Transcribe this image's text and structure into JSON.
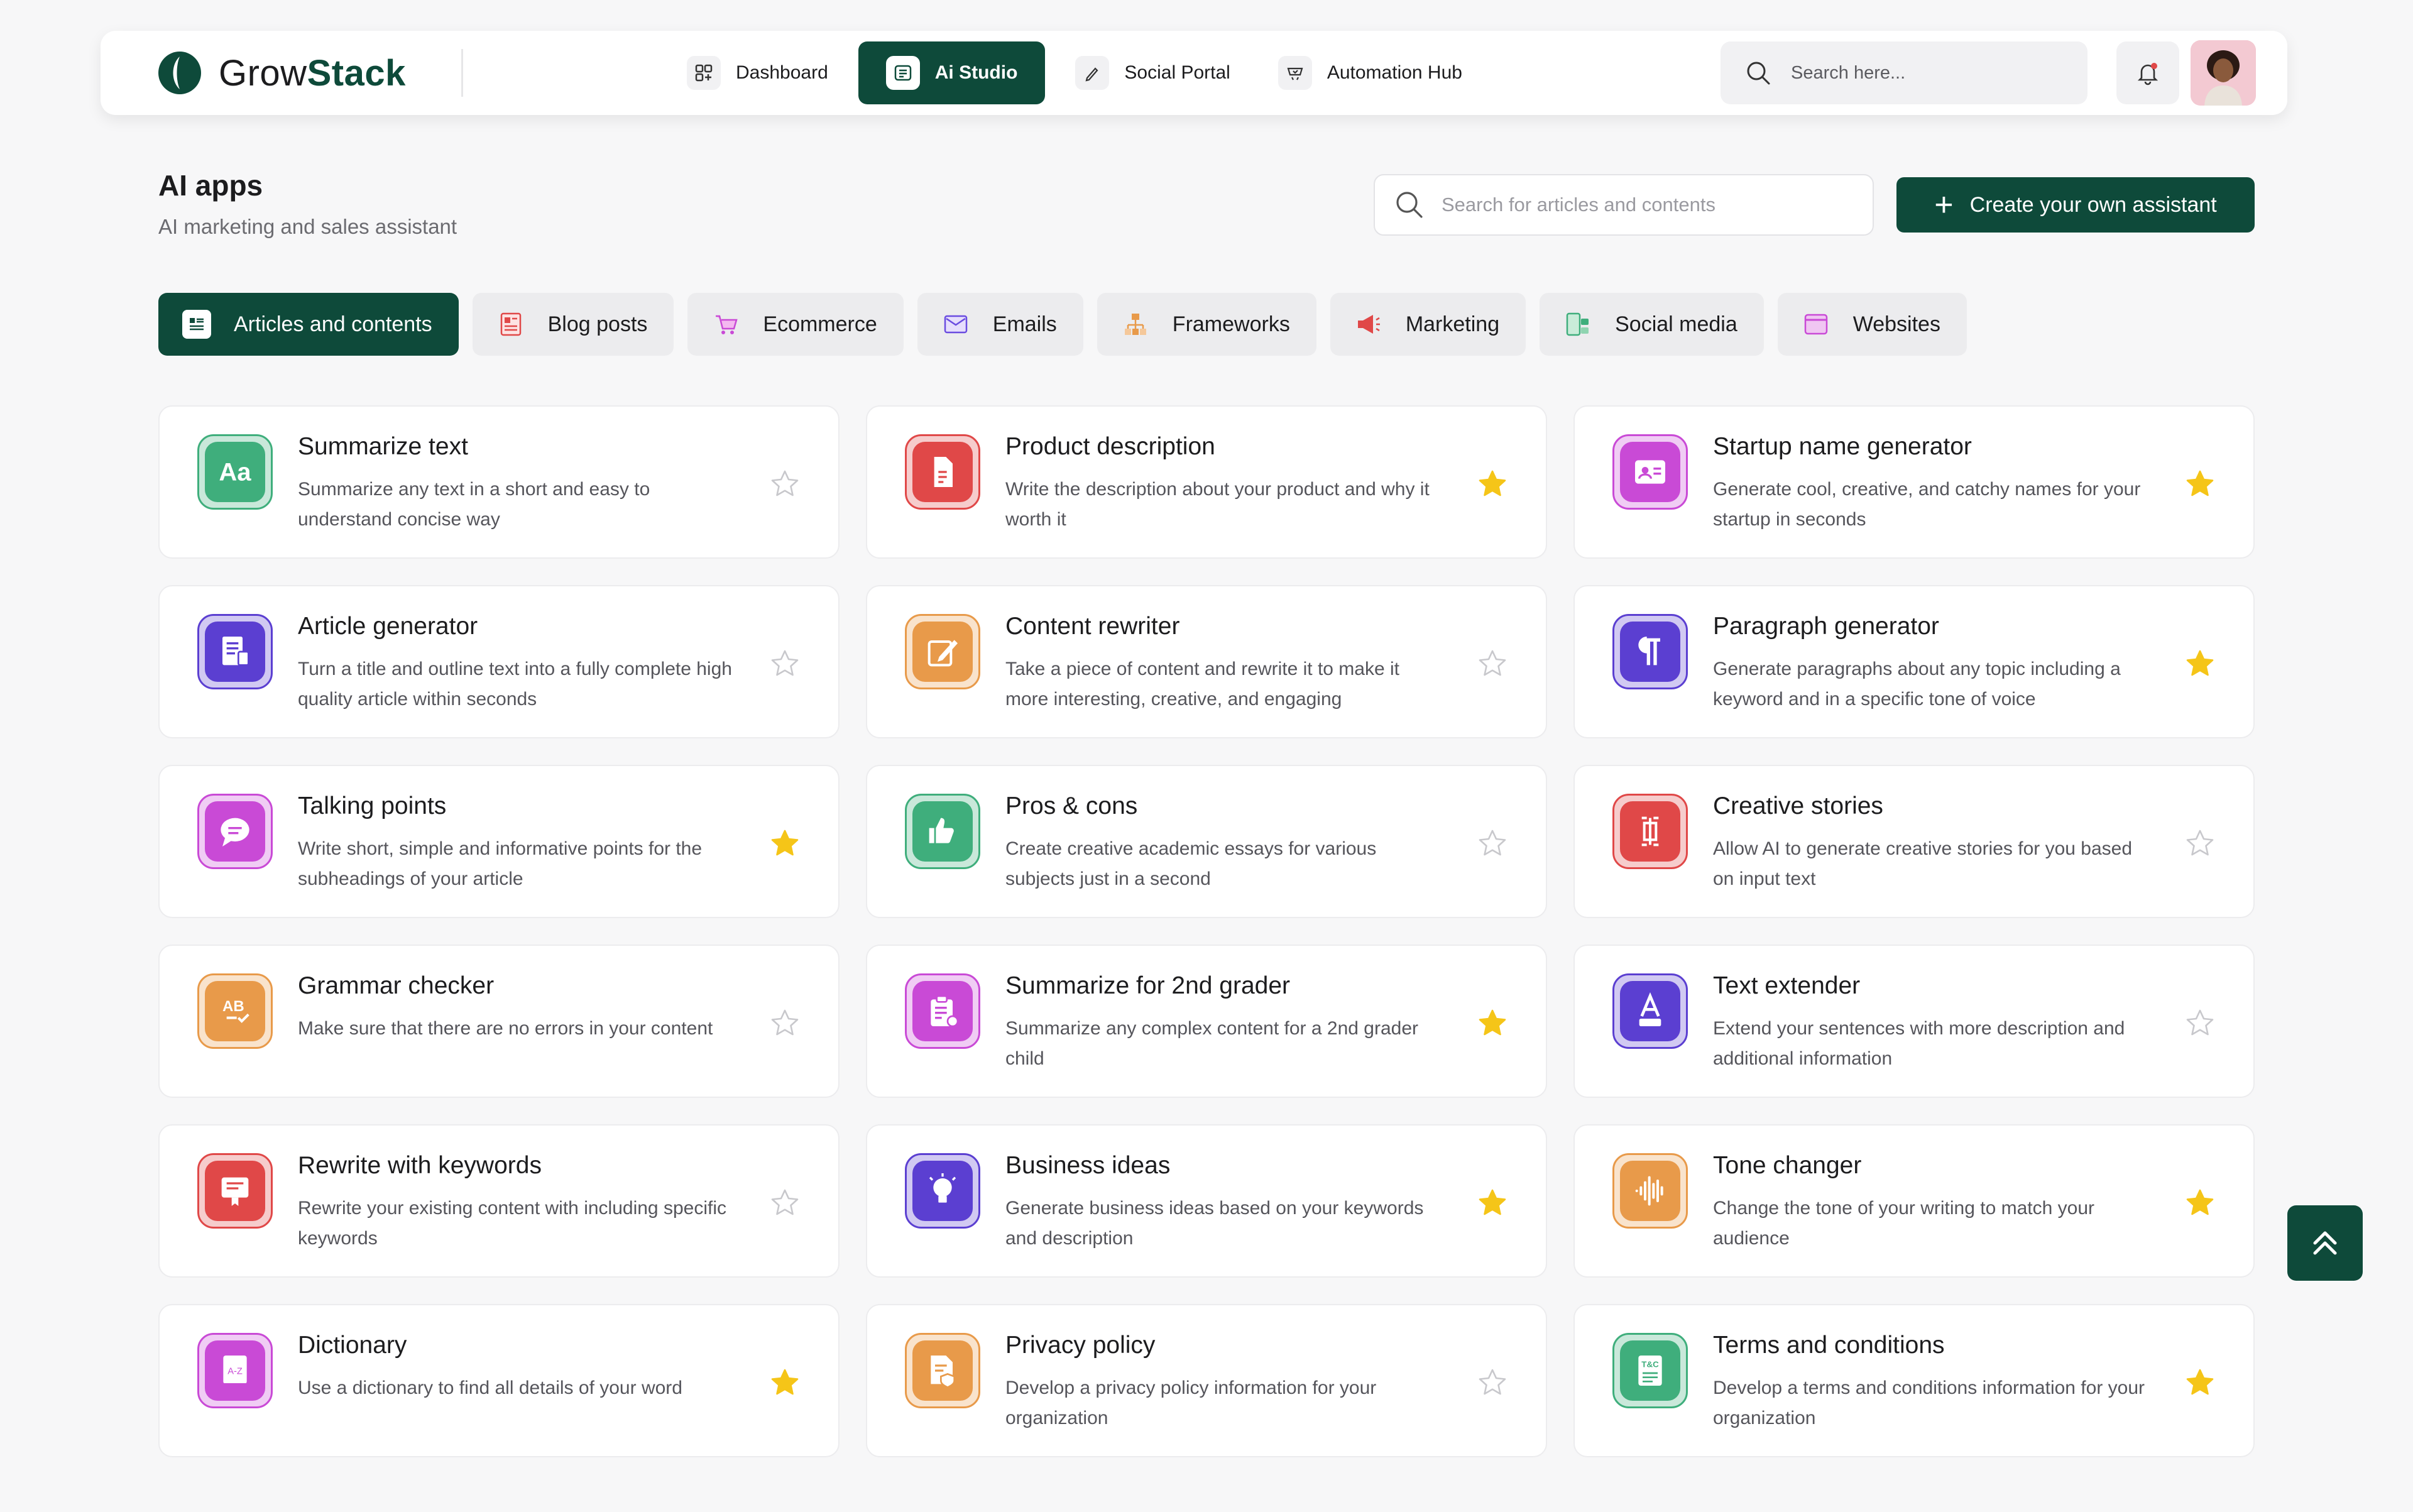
{
  "brand": {
    "name_part1": "Grow",
    "name_part2": "Stack",
    "color": "#0e4a3a"
  },
  "nav": {
    "items": [
      {
        "label": "Dashboard",
        "icon": "grid-icon",
        "active": false
      },
      {
        "label": "Ai Studio",
        "icon": "ai-studio-icon",
        "active": true
      },
      {
        "label": "Social Portal",
        "icon": "pen-icon",
        "active": false
      },
      {
        "label": "Automation Hub",
        "icon": "automation-icon",
        "active": false
      }
    ],
    "search_placeholder": "Search here..."
  },
  "page": {
    "title": "AI apps",
    "subtitle": "AI marketing and sales assistant",
    "search_placeholder": "Search for articles and contents",
    "create_label": "Create your own assistant"
  },
  "tabs": [
    {
      "label": "Articles and contents",
      "icon": "articles-icon",
      "active": true
    },
    {
      "label": "Blog posts",
      "icon": "blog-icon",
      "active": false
    },
    {
      "label": "Ecommerce",
      "icon": "cart-icon",
      "active": false
    },
    {
      "label": "Emails",
      "icon": "email-icon",
      "active": false
    },
    {
      "label": "Frameworks",
      "icon": "framework-icon",
      "active": false
    },
    {
      "label": "Marketing",
      "icon": "megaphone-icon",
      "active": false
    },
    {
      "label": "Social media",
      "icon": "social-icon",
      "active": false
    },
    {
      "label": "Websites",
      "icon": "website-icon",
      "active": false
    }
  ],
  "apps": [
    {
      "title": "Summarize text",
      "desc": "Summarize any text in a short and easy to understand concise way",
      "icon": "text-aa-icon",
      "color": "#3fae7c",
      "favorite": false
    },
    {
      "title": "Product description",
      "desc": "Write the description about your product and why it worth it",
      "icon": "document-icon",
      "color": "#e04848",
      "favorite": true
    },
    {
      "title": "Startup name generator",
      "desc": "Generate cool, creative, and catchy names for your startup in seconds",
      "icon": "id-card-icon",
      "color": "#c94ad6",
      "favorite": true
    },
    {
      "title": "Article generator",
      "desc": "Turn a title and outline text into a fully complete high quality article within seconds",
      "icon": "article-icon",
      "color": "#5b3fd1",
      "favorite": false
    },
    {
      "title": "Content rewriter",
      "desc": "Take a piece of content and rewrite it to make it more interesting, creative, and engaging",
      "icon": "edit-icon",
      "color": "#e89a4a",
      "favorite": false
    },
    {
      "title": "Paragraph generator",
      "desc": "Generate paragraphs about any topic including a keyword and in a specific tone of voice",
      "icon": "pilcrow-icon",
      "color": "#5b3fd1",
      "favorite": true
    },
    {
      "title": "Talking points",
      "desc": "Write short, simple and informative points for the subheadings of your article",
      "icon": "chat-icon",
      "color": "#c94ad6",
      "favorite": true
    },
    {
      "title": "Pros & cons",
      "desc": "Create creative academic essays for various subjects just in a second",
      "icon": "thumbs-icon",
      "color": "#3fae7c",
      "favorite": false
    },
    {
      "title": "Creative stories",
      "desc": "Allow AI to generate creative stories for you based on input text",
      "icon": "text-cursor-icon",
      "color": "#e04848",
      "favorite": false
    },
    {
      "title": "Grammar checker",
      "desc": "Make sure that there are no errors in your content",
      "icon": "ab-check-icon",
      "color": "#e89a4a",
      "favorite": false
    },
    {
      "title": "Summarize for 2nd grader",
      "desc": "Summarize any complex content for a 2nd grader child",
      "icon": "clipboard-icon",
      "color": "#c94ad6",
      "favorite": true
    },
    {
      "title": "Text extender",
      "desc": "Extend your sentences with more description and additional information",
      "icon": "text-extend-icon",
      "color": "#5b3fd1",
      "favorite": false
    },
    {
      "title": "Rewrite with keywords",
      "desc": "Rewrite your existing content with including specific keywords",
      "icon": "keyword-icon",
      "color": "#e04848",
      "favorite": false
    },
    {
      "title": "Business ideas",
      "desc": "Generate business ideas based on your keywords and description",
      "icon": "lightbulb-icon",
      "color": "#5b3fd1",
      "favorite": true
    },
    {
      "title": "Tone changer",
      "desc": "Change the tone of your writing to match your audience",
      "icon": "waveform-icon",
      "color": "#e89a4a",
      "favorite": true
    },
    {
      "title": "Dictionary",
      "desc": "Use a dictionary to find all details of your word",
      "icon": "book-icon",
      "color": "#c94ad6",
      "favorite": true
    },
    {
      "title": "Privacy policy",
      "desc": "Develop a privacy policy information for your organization",
      "icon": "shield-doc-icon",
      "color": "#e89a4a",
      "favorite": false
    },
    {
      "title": "Terms and conditions",
      "desc": "Develop a terms and conditions information for your organization",
      "icon": "terms-icon",
      "color": "#3fae7c",
      "favorite": true
    }
  ],
  "colors": {
    "primary": "#0e4a3a",
    "star": "#f5c518",
    "star_empty": "#c8c8cc"
  }
}
